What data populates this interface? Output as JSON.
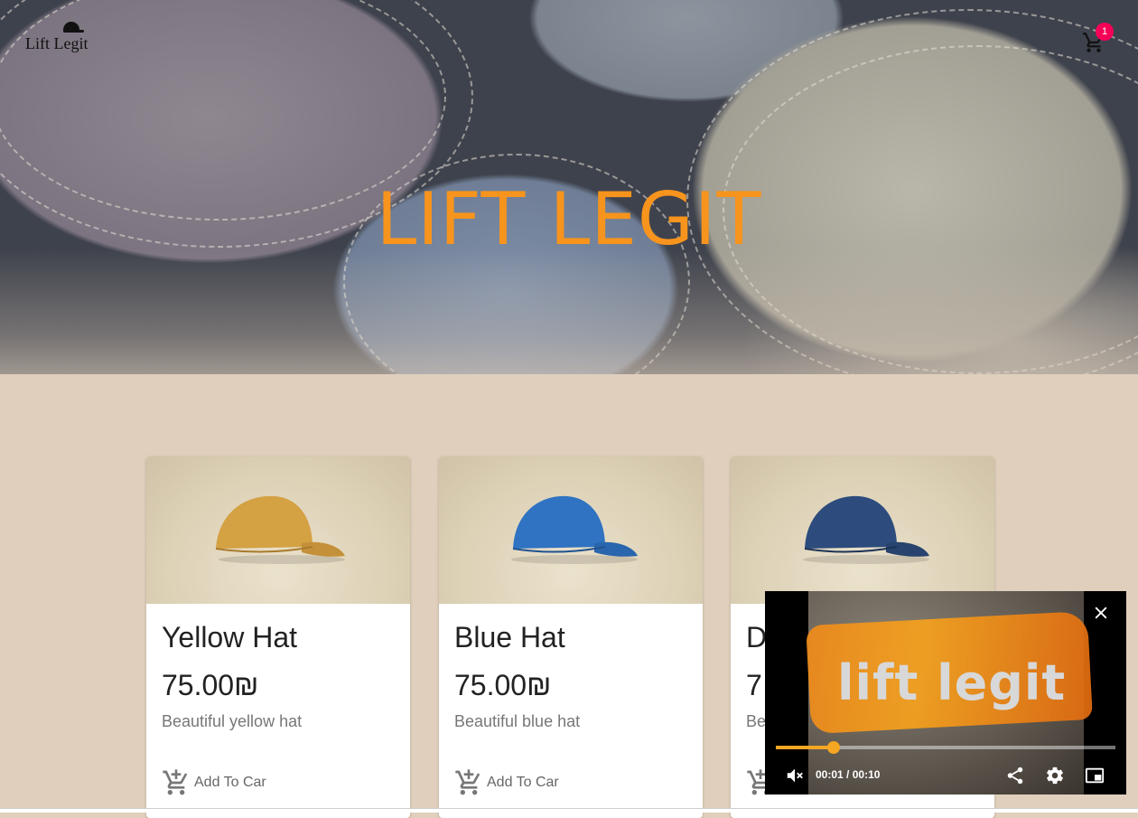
{
  "header": {
    "logo_text": "Lift Legit",
    "cart_count": "1",
    "cart_icon": "shopping-cart-icon"
  },
  "hero": {
    "title": "LIFT LEGIT"
  },
  "products": [
    {
      "title": "Yellow Hat",
      "price": "75.00₪",
      "description": "Beautiful yellow hat",
      "button": "Add To Car",
      "color": "#d4a143"
    },
    {
      "title": "Blue Hat",
      "price": "75.00₪",
      "description": "Beautiful blue hat",
      "button": "Add To Car",
      "color": "#2f73c2"
    },
    {
      "title": "D",
      "price": "7",
      "description": "Be",
      "button": "",
      "color": "#2d4c7d"
    }
  ],
  "video": {
    "overlay_text": "lift legit",
    "current_time": "00:01",
    "separator": "/",
    "duration": "00:10",
    "progress": 0.17,
    "accent": "#f5a623"
  },
  "colors": {
    "page_background": "#e0cfbc",
    "hero_title": "#f7941d",
    "badge": "#f50057"
  }
}
